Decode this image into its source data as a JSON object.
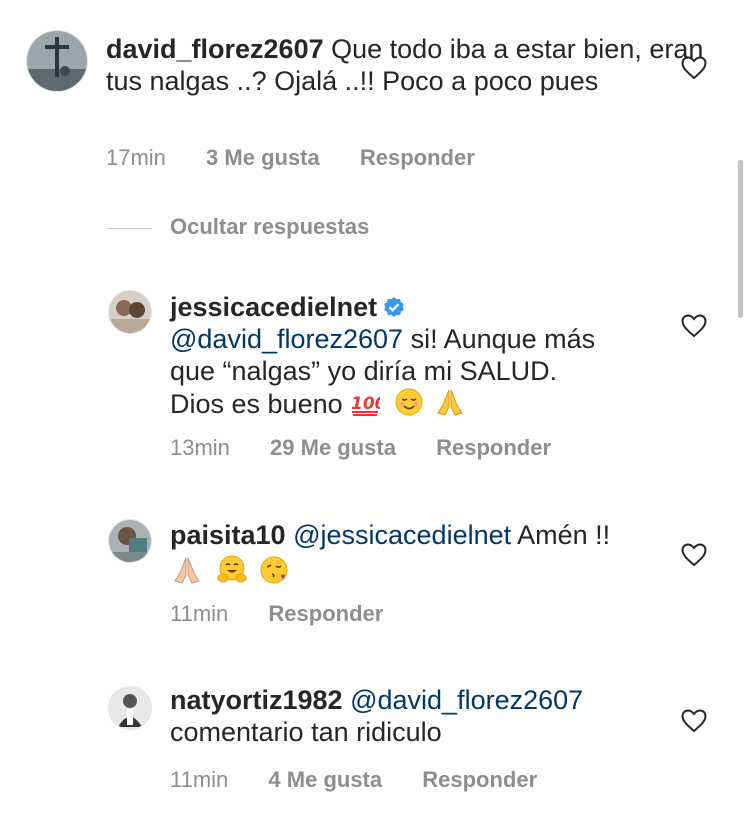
{
  "comments": [
    {
      "username": "david_florez2607",
      "text": "Que todo iba a estar bien, eran tus nalgas ..? Ojalá ..!! Poco a poco pues",
      "time": "17min",
      "likes": "3 Me gusta",
      "reply": "Responder"
    }
  ],
  "hide_replies": "Ocultar respuestas",
  "replies": [
    {
      "username": "jessicacedielnet",
      "mention": "@david_florez2607",
      "text_line1": " si! Aunque más",
      "text_line2": "que “nalgas” yo diría mi SALUD.",
      "text_line3": "Dios es bueno ",
      "emojis": [
        "hundred-points",
        "smiling-face",
        "folded-hands"
      ],
      "time": "13min",
      "likes": "29 Me gusta",
      "reply": "Responder",
      "verified": true
    },
    {
      "username": "paisita10",
      "mention": "@jessicacedielnet",
      "text": " Amén !!",
      "emojis": [
        "folded-hands",
        "hugging-face",
        "face-blowing-kiss"
      ],
      "time": "11min",
      "reply": "Responder"
    },
    {
      "username": "natyortiz1982",
      "mention": "@david_florez2607",
      "text": "comentario tan ridiculo",
      "time": "11min",
      "likes": "4 Me gusta",
      "reply": "Responder"
    }
  ],
  "colors": {
    "text": "#262626",
    "secondary": "#8e8e8e",
    "mention": "#00376b",
    "verified": "#3897f0"
  }
}
